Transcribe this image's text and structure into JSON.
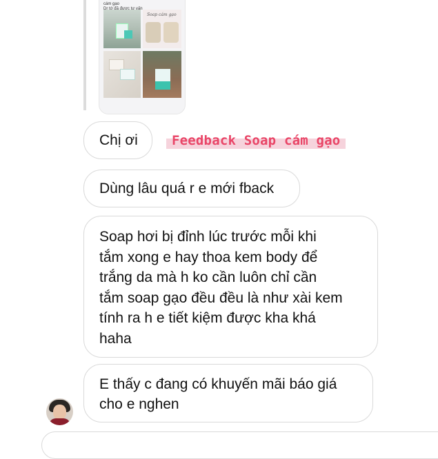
{
  "shared_post": {
    "caption_lines": [
      "cám gạo",
      "Dr tớ đã được tư vấn"
    ],
    "tile_label": "Soap cám gạo"
  },
  "annotation": {
    "text": "Feedback Soap cám gạo",
    "color": "#e94567"
  },
  "messages": [
    {
      "lines": [
        "Chị ơi"
      ]
    },
    {
      "lines": [
        "Dùng lâu quá r e mới fback"
      ]
    },
    {
      "lines": [
        "Soap hơi bị đỉnh lúc trước mỗi khi",
        "tắm xong e hay thoa kem body để",
        "trắng da mà h ko cần luôn chỉ cần",
        "tắm soap gạo đều đều là như xài kem",
        "tính ra h e tiết kiệm được kha khá",
        "haha"
      ]
    },
    {
      "lines": [
        "E thấy c đang có khuyến mãi báo giá",
        "cho e nghen"
      ]
    }
  ],
  "sender": {
    "avatar_icon": "avatar-photo"
  }
}
